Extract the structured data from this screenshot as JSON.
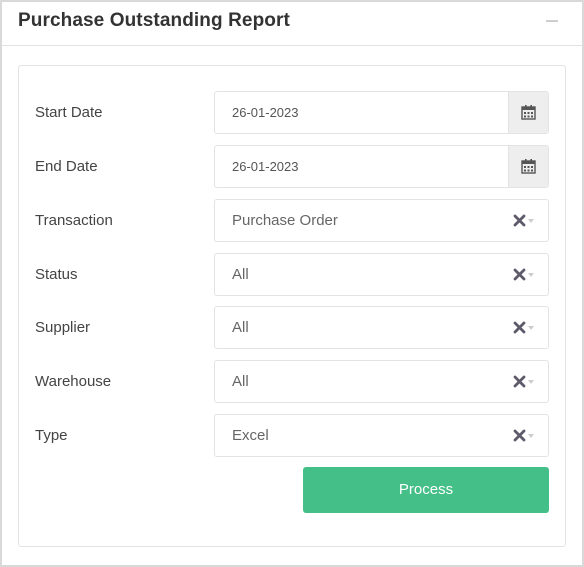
{
  "header": {
    "title": "Purchase Outstanding Report"
  },
  "form": {
    "start_date": {
      "label": "Start Date",
      "value": "26-01-2023"
    },
    "end_date": {
      "label": "End Date",
      "value": "26-01-2023"
    },
    "transaction": {
      "label": "Transaction",
      "value": "Purchase Order"
    },
    "status": {
      "label": "Status",
      "value": "All"
    },
    "supplier": {
      "label": "Supplier",
      "value": "All"
    },
    "warehouse": {
      "label": "Warehouse",
      "value": "All"
    },
    "type": {
      "label": "Type",
      "value": "Excel"
    },
    "process_label": "Process"
  },
  "icons": {
    "calendar": "calendar-icon",
    "clear": "clear-x-icon",
    "caret": "chevron-down-icon",
    "collapse": "minus-icon"
  },
  "colors": {
    "accent": "#44bf87",
    "clear_icon": "#5f5a6a"
  }
}
